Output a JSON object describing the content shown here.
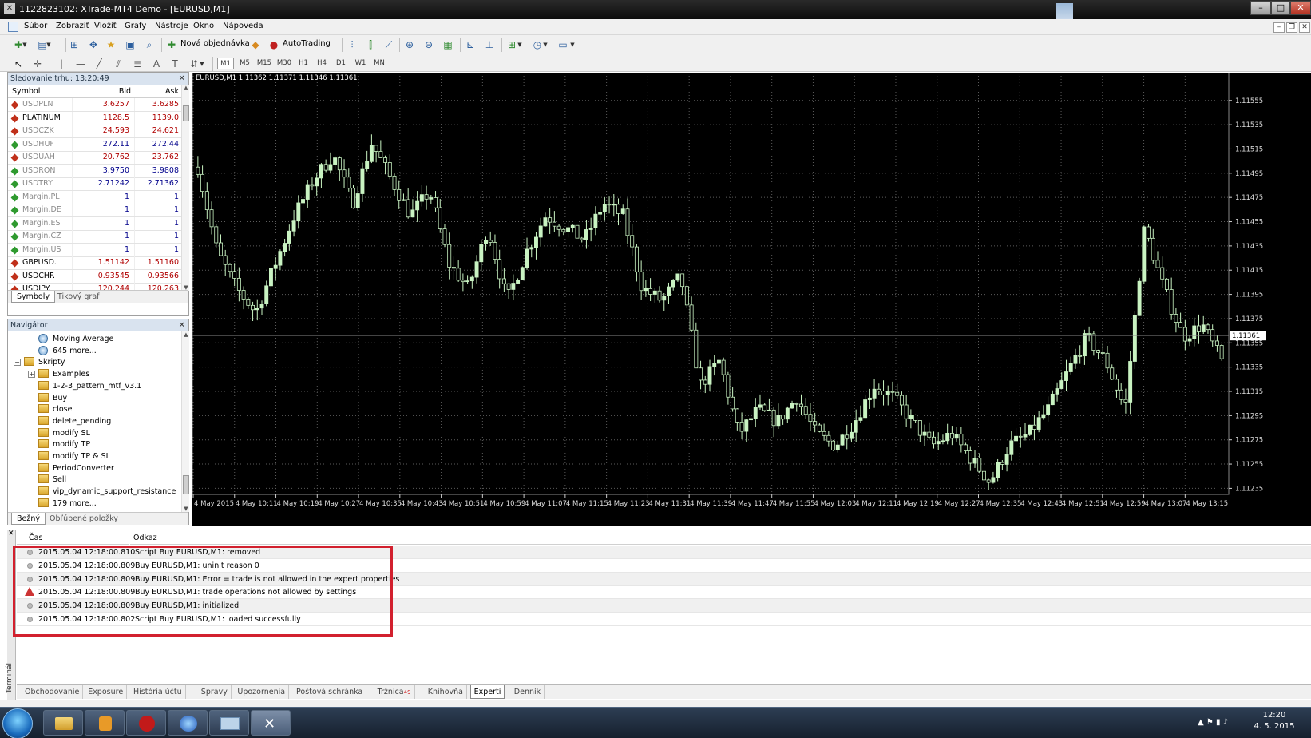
{
  "window": {
    "title": "1122823102: XTrade-MT4 Demo - [EURUSD,M1]"
  },
  "menu": {
    "items": [
      "Súbor",
      "Zobraziť",
      "Vložiť",
      "Grafy",
      "Nástroje",
      "Okno",
      "Nápoveda"
    ]
  },
  "toolbar": {
    "new_order": "Nová objednávka",
    "autotrading": "AutoTrading"
  },
  "periods": [
    "M1",
    "M5",
    "M15",
    "M30",
    "H1",
    "H4",
    "D1",
    "W1",
    "MN"
  ],
  "market_watch": {
    "title": "Sledovanie trhu: 13:20:49",
    "col_symbol": "Symbol",
    "col_bid": "Bid",
    "col_ask": "Ask",
    "rows": [
      {
        "symbol": "USDPLN",
        "bid": "3.6257",
        "ask": "3.6285",
        "dir": "down",
        "inactive": true
      },
      {
        "symbol": "PLATINUM",
        "bid": "1128.5",
        "ask": "1139.0",
        "dir": "down",
        "inactive": false
      },
      {
        "symbol": "USDCZK",
        "bid": "24.593",
        "ask": "24.621",
        "dir": "down",
        "inactive": true
      },
      {
        "symbol": "USDHUF",
        "bid": "272.11",
        "ask": "272.44",
        "dir": "up",
        "inactive": true
      },
      {
        "symbol": "USDUAH",
        "bid": "20.762",
        "ask": "23.762",
        "dir": "down",
        "inactive": true
      },
      {
        "symbol": "USDRON",
        "bid": "3.9750",
        "ask": "3.9808",
        "dir": "up",
        "inactive": true
      },
      {
        "symbol": "USDTRY",
        "bid": "2.71242",
        "ask": "2.71362",
        "dir": "up",
        "inactive": true
      },
      {
        "symbol": "Margin.PL",
        "bid": "1",
        "ask": "1",
        "dir": "up",
        "inactive": true
      },
      {
        "symbol": "Margin.DE",
        "bid": "1",
        "ask": "1",
        "dir": "up",
        "inactive": true
      },
      {
        "symbol": "Margin.ES",
        "bid": "1",
        "ask": "1",
        "dir": "up",
        "inactive": true
      },
      {
        "symbol": "Margin.CZ",
        "bid": "1",
        "ask": "1",
        "dir": "up",
        "inactive": true
      },
      {
        "symbol": "Margin.US",
        "bid": "1",
        "ask": "1",
        "dir": "up",
        "inactive": true
      },
      {
        "symbol": "GBPUSD.",
        "bid": "1.51142",
        "ask": "1.51160",
        "dir": "down",
        "inactive": false
      },
      {
        "symbol": "USDCHF.",
        "bid": "0.93545",
        "ask": "0.93566",
        "dir": "down",
        "inactive": false
      },
      {
        "symbol": "USDJPY.",
        "bid": "120.244",
        "ask": "120.263",
        "dir": "down",
        "inactive": false
      }
    ],
    "tabs": [
      "Symboly",
      "Tikový graf"
    ]
  },
  "navigator": {
    "title": "Navigátor",
    "items": [
      {
        "label": "Moving Average",
        "kind": "indicator",
        "indent": 2
      },
      {
        "label": "645 more...",
        "kind": "indicator",
        "indent": 2
      },
      {
        "label": "Skripty",
        "kind": "folder",
        "indent": 1,
        "expander": "−"
      },
      {
        "label": "Examples",
        "kind": "folder",
        "indent": 2,
        "expander": "+"
      },
      {
        "label": "1-2-3_pattern_mtf_v3.1",
        "kind": "script",
        "indent": 2
      },
      {
        "label": "Buy",
        "kind": "script",
        "indent": 2
      },
      {
        "label": "close",
        "kind": "script",
        "indent": 2
      },
      {
        "label": "delete_pending",
        "kind": "script",
        "indent": 2
      },
      {
        "label": "modify SL",
        "kind": "script",
        "indent": 2
      },
      {
        "label": "modify TP",
        "kind": "script",
        "indent": 2
      },
      {
        "label": "modify TP & SL",
        "kind": "script",
        "indent": 2
      },
      {
        "label": "PeriodConverter",
        "kind": "script",
        "indent": 2
      },
      {
        "label": "Sell",
        "kind": "script",
        "indent": 2
      },
      {
        "label": "vip_dynamic_support_resistance",
        "kind": "script",
        "indent": 2
      },
      {
        "label": "179 more...",
        "kind": "script",
        "indent": 2
      }
    ],
    "tabs": [
      "Bežný",
      "Obľúbené položky"
    ]
  },
  "chart_data": {
    "type": "candlestick",
    "title": "EURUSD,M1  1.11362 1.11371 1.11346 1.11361",
    "ylim": [
      1.1123,
      1.1157
    ],
    "y_ticks": [
      "1.11555",
      "1.11535",
      "1.11515",
      "1.11495",
      "1.11475",
      "1.11455",
      "1.11435",
      "1.11415",
      "1.11395",
      "1.11375",
      "1.11355",
      "1.11335",
      "1.11315",
      "1.11295",
      "1.11275",
      "1.11255",
      "1.11235"
    ],
    "current_price": "1.11361",
    "x_ticks": [
      "4 May 2015",
      "4 May 10:11",
      "4 May 10:19",
      "4 May 10:27",
      "4 May 10:35",
      "4 May 10:43",
      "4 May 10:51",
      "4 May 10:59",
      "4 May 11:07",
      "4 May 11:15",
      "4 May 11:23",
      "4 May 11:31",
      "4 May 11:39",
      "4 May 11:47",
      "4 May 11:55",
      "4 May 12:03",
      "4 May 12:11",
      "4 May 12:19",
      "4 May 12:27",
      "4 May 12:35",
      "4 May 12:43",
      "4 May 12:51",
      "4 May 12:59",
      "4 May 13:07",
      "4 May 13:15"
    ],
    "close_path": [
      1.115,
      1.1143,
      1.114,
      1.1138,
      1.1142,
      1.1146,
      1.1149,
      1.1151,
      1.1147,
      1.1152,
      1.1149,
      1.1146,
      1.1148,
      1.1142,
      1.114,
      1.1145,
      1.1139,
      1.1143,
      1.1146,
      1.1145,
      1.1144,
      1.1147,
      1.1146,
      1.114,
      1.1139,
      1.1141,
      1.1132,
      1.1134,
      1.1128,
      1.113,
      1.1129,
      1.1131,
      1.1128,
      1.1127,
      1.1129,
      1.1132,
      1.1131,
      1.1129,
      1.1127,
      1.1128,
      1.1126,
      1.1124,
      1.1127,
      1.1128,
      1.113,
      1.1133,
      1.1136,
      1.1134,
      1.113,
      1.1145,
      1.114,
      1.1136,
      1.1137,
      1.1134
    ]
  },
  "terminal": {
    "side_label": "Terminál",
    "col_time": "Čas",
    "col_message": "Odkaz",
    "rows": [
      {
        "time": "2015.05.04 12:18:00.810",
        "message": "Script Buy EURUSD,M1: removed",
        "icon": "info"
      },
      {
        "time": "2015.05.04 12:18:00.809",
        "message": "Buy EURUSD,M1: uninit reason 0",
        "icon": "info"
      },
      {
        "time": "2015.05.04 12:18:00.809",
        "message": "Buy EURUSD,M1: Error = trade is not allowed in the expert properties",
        "icon": "info"
      },
      {
        "time": "2015.05.04 12:18:00.809",
        "message": "Buy EURUSD,M1: trade operations not allowed by settings",
        "icon": "warning"
      },
      {
        "time": "2015.05.04 12:18:00.809",
        "message": "Buy EURUSD,M1: initialized",
        "icon": "info"
      },
      {
        "time": "2015.05.04 12:18:00.802",
        "message": "Script Buy EURUSD,M1: loaded successfully",
        "icon": "info"
      }
    ],
    "tabs": [
      {
        "label": "Obchodovanie",
        "active": false
      },
      {
        "label": "Exposure",
        "active": false
      },
      {
        "label": "História účtu",
        "active": false
      },
      {
        "label": "Správy",
        "active": false
      },
      {
        "label": "Upozornenia",
        "active": false
      },
      {
        "label": "Poštová schránka",
        "active": false
      },
      {
        "label": "Tržnica",
        "badge": "49",
        "active": false
      },
      {
        "label": "Knihovňa",
        "active": false
      },
      {
        "label": "Experti",
        "active": true
      },
      {
        "label": "Denník",
        "active": false
      }
    ]
  },
  "taskbar": {
    "time": "12:20",
    "date": "4. 5. 2015"
  },
  "colors": {
    "bullish": "#c9f3c2",
    "bearish_wick": "#c9f3c2",
    "chart_bg": "#000000",
    "grid": "#5c5c5c",
    "bid_down": "#b00000",
    "bid_up": "#00008b",
    "highlight": "#d2202e"
  }
}
